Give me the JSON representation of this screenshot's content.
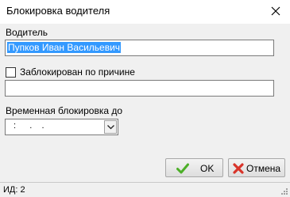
{
  "window": {
    "title": "Блокировка водителя",
    "close_icon": "close-icon"
  },
  "form": {
    "driver_label": "Водитель",
    "driver_value": "Пупков Иван Васильевич",
    "blocked_label": "Заблокирован по причине",
    "blocked_checked": false,
    "reason_value": "",
    "temp_block_label": "Временная блокировка до",
    "temp_block_value": " :   .  .",
    "dropdown_icon": "chevron-down-icon"
  },
  "buttons": {
    "ok_label": "OK",
    "ok_icon": "checkmark-icon",
    "cancel_label": "Отмена",
    "cancel_icon": "cross-icon"
  },
  "status": {
    "id_text": "ИД: 2"
  },
  "colors": {
    "selection": "#3399ff",
    "ok_icon": "#4caf28",
    "cancel_icon": "#d8342a"
  }
}
